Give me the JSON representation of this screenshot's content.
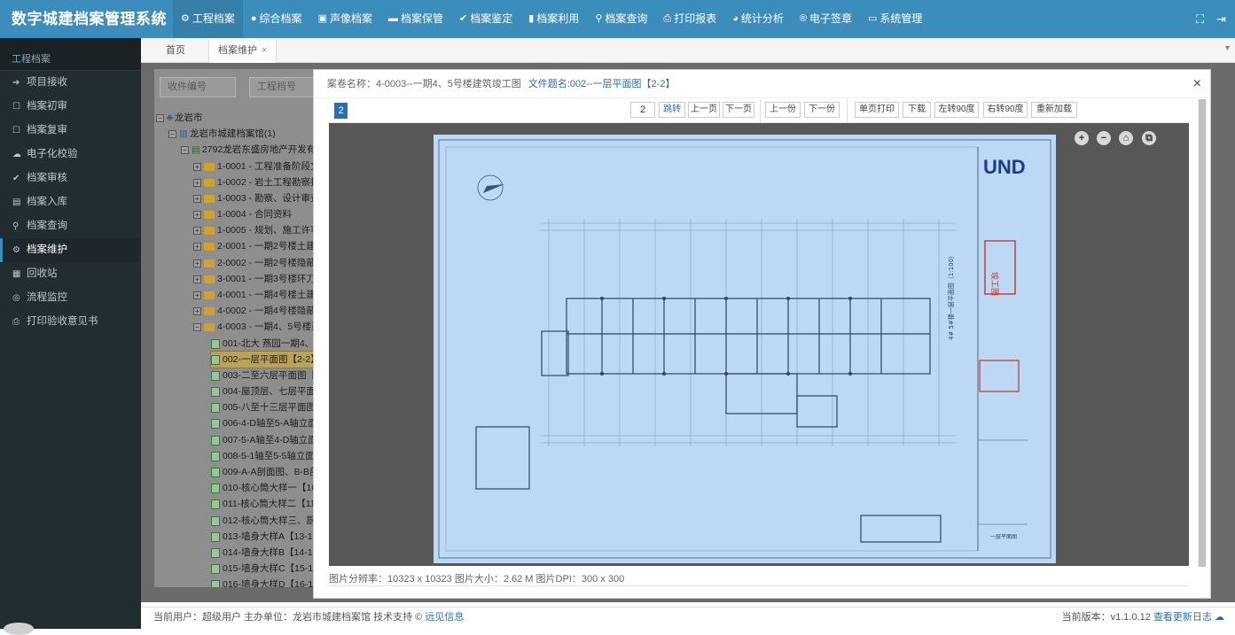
{
  "app": {
    "title": "数字城建档案管理系统"
  },
  "nav": [
    {
      "icon": "gear",
      "label": "工程档案"
    },
    {
      "icon": "dot",
      "label": "综合档案"
    },
    {
      "icon": "film",
      "label": "声像档案"
    },
    {
      "icon": "box",
      "label": "档案保管"
    },
    {
      "icon": "check",
      "label": "档案鉴定"
    },
    {
      "icon": "bookmark",
      "label": "档案利用"
    },
    {
      "icon": "search",
      "label": "档案查询"
    },
    {
      "icon": "print",
      "label": "打印报表"
    },
    {
      "icon": "pie",
      "label": "统计分析"
    },
    {
      "icon": "seal",
      "label": "电子签章"
    },
    {
      "icon": "monitor",
      "label": "系统管理"
    }
  ],
  "sidebar": {
    "header": "工程档案",
    "items": [
      {
        "icon": "➔",
        "label": "项目接收"
      },
      {
        "icon": "☐",
        "label": "档案初审"
      },
      {
        "icon": "☐",
        "label": "档案复审"
      },
      {
        "icon": "☁",
        "label": "电子化校验"
      },
      {
        "icon": "✔",
        "label": "档案审核"
      },
      {
        "icon": "▤",
        "label": "档案入库"
      },
      {
        "icon": "⚲",
        "label": "档案查询"
      },
      {
        "icon": "⚙",
        "label": "档案维护"
      },
      {
        "icon": "▦",
        "label": "回收站"
      },
      {
        "icon": "◎",
        "label": "流程监控"
      },
      {
        "icon": "⎙",
        "label": "打印验收意见书"
      }
    ],
    "active_index": 7
  },
  "tabs": [
    {
      "label": "首页"
    },
    {
      "label": "档案维护",
      "close": "×"
    }
  ],
  "search": {
    "field1": "收件编号",
    "field2": "工程档号"
  },
  "tree": {
    "root": "龙岩市",
    "level1": "龙岩市城建档案馆(1)",
    "level2": "2792龙岩东盛房地产开发有限",
    "folders": [
      "1-0001 - 工程准备阶段文件",
      "1-0002 - 岩土工程勘察报",
      "1-0003 - 勘察、设计审查",
      "1-0004 - 合同资料",
      "1-0005 - 规划、施工许可",
      "2-0001 - 一期2号楼土建",
      "2-0002 - 一期2号楼隐蔽",
      "3-0001 - 一期3号楼环刀法",
      "4-0001 - 一期4号楼土建",
      "4-0002 - 一期4号楼隐蔽",
      "4-0003 - 一期4、5号楼建"
    ],
    "files": [
      "001-北大 燕园一期4、",
      "002-一层平面图【2-2】",
      "003-二至六层平面图【",
      "004-屋顶层、七层平面",
      "005-八至十三层平面图",
      "006-4-D轴至5-A轴立面",
      "007-5-A轴至4-D轴立面",
      "008-5-1轴至5-5轴立面",
      "009-A-A剖面图、B-B剖",
      "010-核心筒大样一【10",
      "011-核心筒大样二【11",
      "012-核心筒大样三、厨",
      "013-墙身大样A【13-1",
      "014-墙身大样B【14-1",
      "015-墙身大样C【15-1",
      "016-墙身大样D【16-1"
    ],
    "selected_file_index": 1
  },
  "modal": {
    "case_label": "案卷名称：4-0003--一期4、5号楼建筑竣工图",
    "file_label": "文件题名:002--一层平面图【2-2】",
    "close": "×"
  },
  "viewer": {
    "page_badge": "2",
    "page_input": "2",
    "jump": "跳转",
    "prev_page": "上一页",
    "next_page": "下一页",
    "prev_doc": "上一份",
    "next_doc": "下一份",
    "print_single": "单页打印",
    "download": "下载",
    "rotate_left": "左转90度",
    "rotate_right": "右转90度",
    "reload": "重新加载",
    "zoom_in": "+",
    "zoom_out": "−",
    "zoom_reset": "⌂",
    "zoom_fit": "⧉",
    "status": "图片分辨率：10323 x 10323 图片大小：2.62 M 图片DPI：300 x 300",
    "logo_text": "UND",
    "stamp_text": "竣工图",
    "vertical_title": "4# 5#楼一层平面图（1:100）",
    "block_title": "一层平面图"
  },
  "footer": {
    "left_prefix": "当前用户：超级用户 主办单位：龙岩市城建档案馆 技术支持 ©",
    "support_link": "远见信息",
    "version": "当前版本：v1.1.0.12",
    "changelog_link": "查看更新日志"
  }
}
